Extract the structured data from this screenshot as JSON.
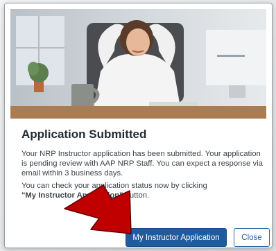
{
  "dialog": {
    "title": "Application Submitted",
    "paragraph1": "Your NRP Instructor application has been submitted. Your application is pending review with AAP NRP Staff. You can expect a response via email within 3 business days.",
    "paragraph2_prefix": "You can check your application status now by clicking",
    "paragraph2_button_ref": "\"My Instructor Application\"",
    "paragraph2_suffix": " button.",
    "buttons": {
      "primary_label": "My Instructor Application",
      "close_label": "Close"
    }
  },
  "colors": {
    "primary": "#1f5c9e",
    "annotation_arrow": "#c00000"
  },
  "icons": {
    "annotation": "pointer-arrow-icon"
  }
}
